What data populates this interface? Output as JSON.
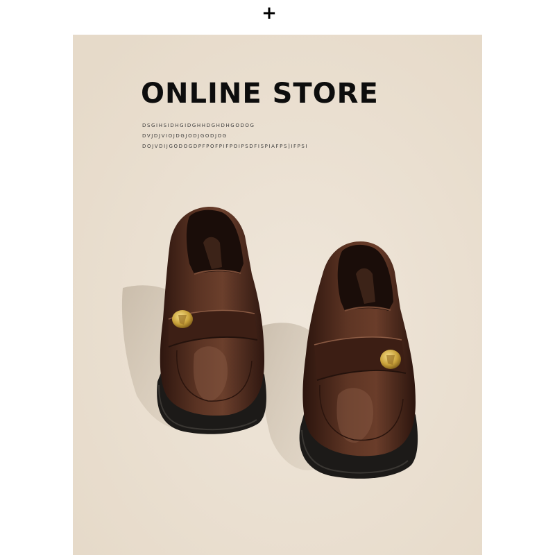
{
  "top_mark": "+",
  "banner": {
    "title": "ONLINE STORE",
    "lines": [
      "DSGIHSIDHGIDGHHDGHDHGODOG",
      "DVJDJVIOJDGJODJGODJOG",
      "DOJVDIJGODOGDPFPOFPIFPOIPSDFISPIAFPS]IFPSI"
    ]
  },
  "colors": {
    "panel_background": "#ece2d4",
    "shoe_leather": "#4a2a1e",
    "sole": "#1c1a18",
    "buckle": "#c9a23a"
  },
  "illustration": {
    "subject": "pair of brown patent leather loafers with gold buckles",
    "icon": "loafers-photo"
  }
}
